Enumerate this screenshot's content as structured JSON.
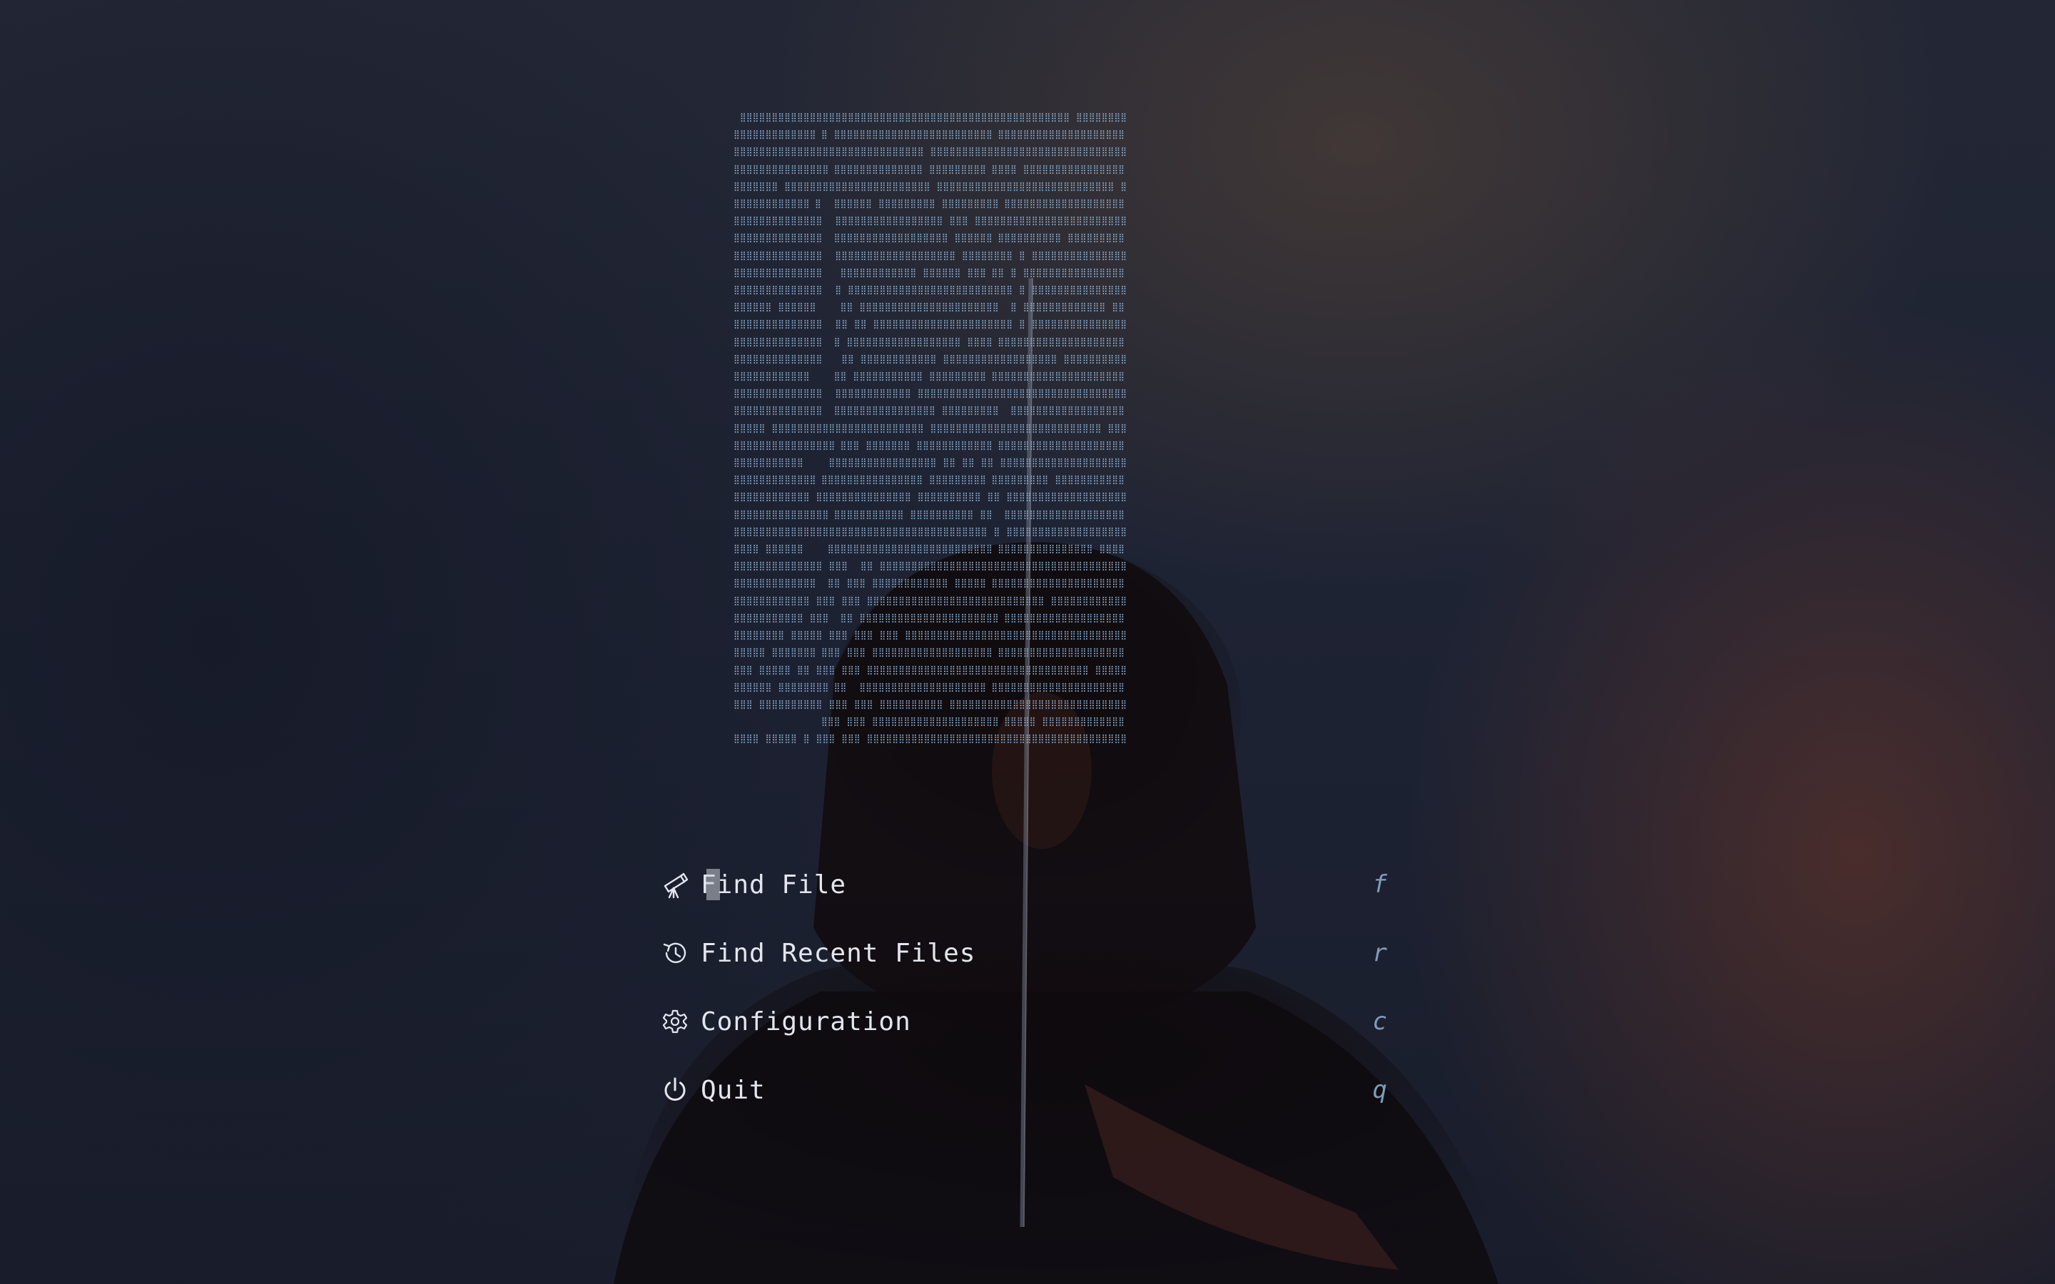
{
  "background": {
    "accent_colors": [
      "#1c2130",
      "#3a3128",
      "#5a2e26"
    ],
    "figure": "samurai-figure-with-sword"
  },
  "ascii_art": {
    "color": "#8fb3d6",
    "glyph": "dot-matrix-braille"
  },
  "menu": {
    "items": [
      {
        "icon": "telescope-icon",
        "label": "Find File",
        "key": "f",
        "selected": true
      },
      {
        "icon": "history-icon",
        "label": "Find Recent Files",
        "key": "r",
        "selected": false
      },
      {
        "icon": "gear-icon",
        "label": "Configuration",
        "key": "c",
        "selected": false
      },
      {
        "icon": "power-icon",
        "label": "Quit",
        "key": "q",
        "selected": false
      }
    ]
  }
}
